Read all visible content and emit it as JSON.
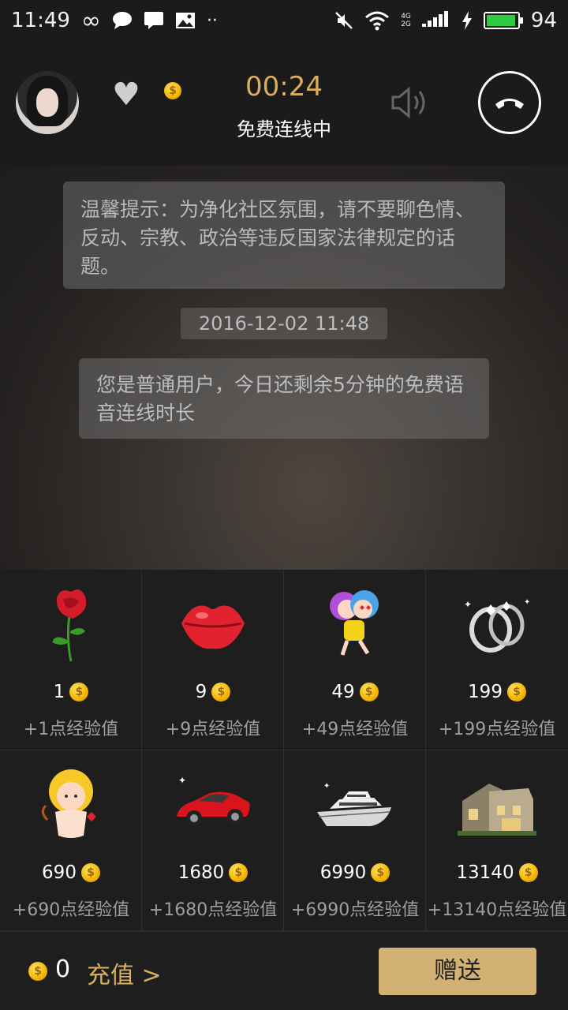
{
  "status_bar": {
    "time": "11:49",
    "infinity_icon": "∞",
    "net_top": "4G",
    "net_bottom": "2G",
    "battery": "94"
  },
  "call": {
    "timer": "00:24",
    "status": "免费连线中"
  },
  "chat": {
    "notice": "温馨提示：为净化社区氛围，请不要聊色情、反动、宗教、政治等违反国家法律规定的话题。",
    "timestamp": "2016-12-02 11:48",
    "system_message": "您是普通用户，今日还剩余5分钟的免费语音连线时长"
  },
  "gifts": [
    {
      "name": "rose",
      "price": "1",
      "exp": "+1点经验值"
    },
    {
      "name": "kiss",
      "price": "9",
      "exp": "+9点经验值"
    },
    {
      "name": "hug",
      "price": "49",
      "exp": "+49点经验值"
    },
    {
      "name": "ring",
      "price": "199",
      "exp": "+199点经验值"
    },
    {
      "name": "cupid",
      "price": "690",
      "exp": "+690点经验值"
    },
    {
      "name": "sports-car",
      "price": "1680",
      "exp": "+1680点经验值"
    },
    {
      "name": "yacht",
      "price": "6990",
      "exp": "+6990点经验值"
    },
    {
      "name": "villa",
      "price": "13140",
      "exp": "+13140点经验值"
    }
  ],
  "footer": {
    "balance": "0",
    "recharge_label": "充值 >",
    "send_label": "赠送"
  },
  "colors": {
    "accent_gold": "#d9ae5f",
    "button_gold": "#d3b172",
    "battery_green": "#2ecc40"
  }
}
